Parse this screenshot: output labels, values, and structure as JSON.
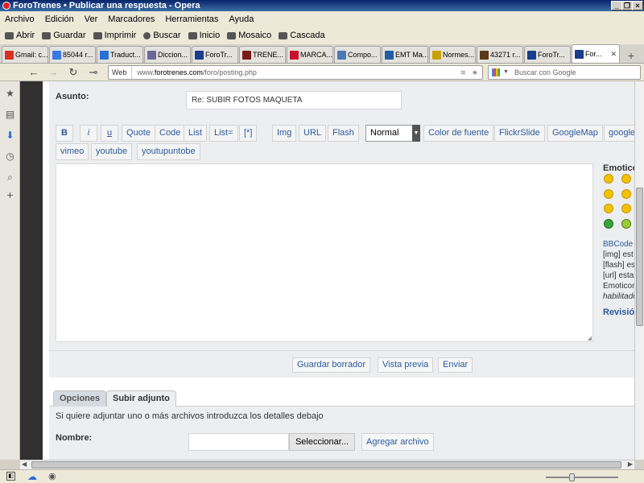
{
  "window": {
    "title": "ForoTrenes • Publicar una respuesta - Opera"
  },
  "menu": [
    "Archivo",
    "Edición",
    "Ver",
    "Marcadores",
    "Herramientas",
    "Ayuda"
  ],
  "toolbar": [
    {
      "label": "Abrir",
      "icon": "folder-icon"
    },
    {
      "label": "Guardar",
      "icon": "save-icon"
    },
    {
      "label": "Imprimir",
      "icon": "print-icon"
    },
    {
      "label": "Buscar",
      "icon": "search-icon"
    },
    {
      "label": "Inicio",
      "icon": "home-icon"
    },
    {
      "label": "Mosaico",
      "icon": "tile-icon"
    },
    {
      "label": "Cascada",
      "icon": "cascade-icon"
    }
  ],
  "tabs": [
    {
      "label": "Gmail: c...",
      "color": "#d93025"
    },
    {
      "label": "85044 r...",
      "color": "#3b78e7"
    },
    {
      "label": "Traduct...",
      "color": "#2a6fd6"
    },
    {
      "label": "Diccion...",
      "color": "#6a6a9a"
    },
    {
      "label": "ForoTr...",
      "color": "#1a3d8c"
    },
    {
      "label": "TRENE...",
      "color": "#7a1a1a"
    },
    {
      "label": "MARCA...",
      "color": "#c8102e"
    },
    {
      "label": "Compo...",
      "color": "#4a7ab5"
    },
    {
      "label": "EMT Ma...",
      "color": "#1f5ea8"
    },
    {
      "label": "Normes...",
      "color": "#c8a000"
    },
    {
      "label": "43271 r...",
      "color": "#5a3a1a"
    },
    {
      "label": "ForoTr...",
      "color": "#1a3d8c"
    },
    {
      "label": "For...",
      "color": "#1a3d8c",
      "active": true
    }
  ],
  "address": {
    "web_label": "Web",
    "url_prefix": "www.",
    "url_domain": "forotrenes.com",
    "url_path": "/foro/posting.php",
    "search_placeholder": "Buscar con Google"
  },
  "form": {
    "subject_label": "Asunto:",
    "subject_value": "Re: SUBIR FOTOS MAQUETA",
    "bbcode_row1": [
      "B",
      "i",
      "u",
      "Quote",
      "Code",
      "List",
      "List=",
      "[*]",
      "Img",
      "URL",
      "Flash"
    ],
    "font_size": "Normal",
    "bbcode_row1b": [
      "Color de fuente",
      "FlickrSlide",
      "GoogleMap",
      "google"
    ],
    "bbcode_row2": [
      "vimeo",
      "youtube",
      "youtupuntobe"
    ],
    "emoticons_header": "Emotico",
    "bbinfo": {
      "line1_link": "BBCode",
      "line1_rest": " e",
      "line2": "[img] est",
      "line3": "[flash] es",
      "line4": "[url] esta",
      "line5": "Emoticon",
      "line6": "habilitado"
    },
    "revision": "Revisión",
    "actions": [
      "Guardar borrador",
      "Vista previa",
      "Enviar"
    ],
    "panel_tabs": [
      "Opciones",
      "Subir adjunto"
    ],
    "attach_desc": "Si quiere adjuntar uno o más archivos introduzca los detalles debajo",
    "name_label": "Nombre:",
    "select_button": "Seleccionar...",
    "add_button": "Agregar archivo"
  }
}
